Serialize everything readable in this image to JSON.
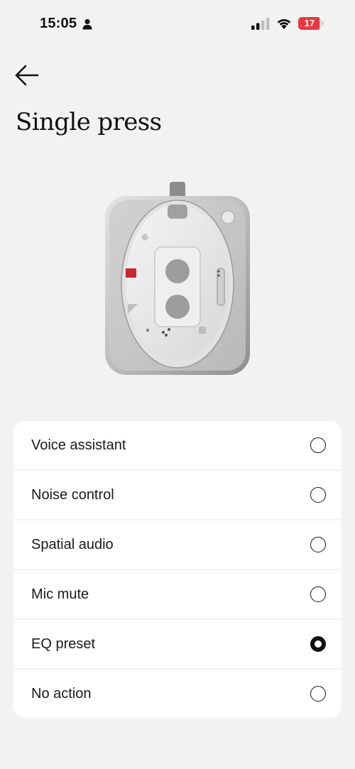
{
  "status_bar": {
    "time": "15:05",
    "person_icon": "person-icon",
    "signal_icon": "cellular-signal-icon",
    "wifi_icon": "wifi-icon",
    "battery_level": "17",
    "battery_color": "#e5393f"
  },
  "header": {
    "back_icon": "arrow-left-icon",
    "title": "Single press"
  },
  "device_image": {
    "description_icon": "earbuds-case-image"
  },
  "options": [
    {
      "label": "Voice assistant",
      "selected": false
    },
    {
      "label": "Noise control",
      "selected": false
    },
    {
      "label": "Spatial audio",
      "selected": false
    },
    {
      "label": "Mic mute",
      "selected": false
    },
    {
      "label": "EQ preset",
      "selected": true
    },
    {
      "label": "No action",
      "selected": false
    }
  ]
}
